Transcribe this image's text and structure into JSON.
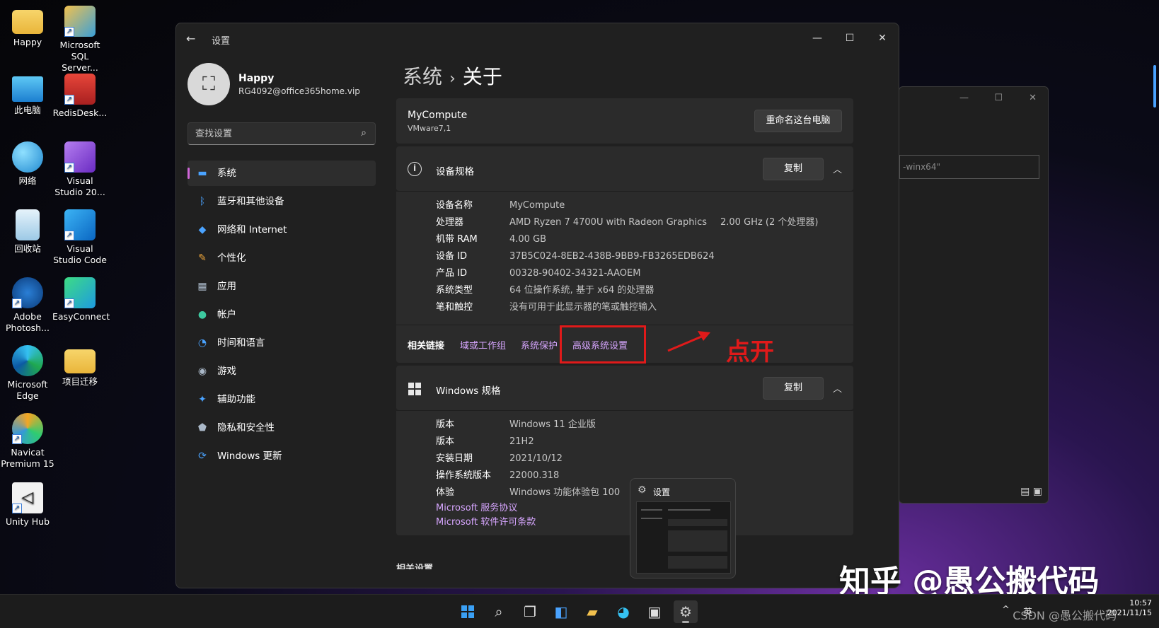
{
  "desktop": {
    "icons": [
      {
        "label": "Happy"
      },
      {
        "label": "Microsoft SQL Server..."
      },
      {
        "label": "此电脑"
      },
      {
        "label": "RedisDesk..."
      },
      {
        "label": "网络"
      },
      {
        "label": "Visual Studio 20..."
      },
      {
        "label": "回收站"
      },
      {
        "label": "Visual Studio Code"
      },
      {
        "label": "Adobe Photosh..."
      },
      {
        "label": "EasyConnect"
      },
      {
        "label": "Microsoft Edge"
      },
      {
        "label": "项目迁移"
      },
      {
        "label": "Navicat Premium 15"
      },
      {
        "label": "Unity Hub"
      }
    ]
  },
  "bg_window": {
    "input_value": "-winx64\""
  },
  "window": {
    "title": "设置",
    "back": "←",
    "minimize": "—",
    "maximize": "☐",
    "close": "✕"
  },
  "profile": {
    "name": "Happy",
    "email": "RG4092@office365home.vip"
  },
  "search": {
    "placeholder": "查找设置"
  },
  "nav": {
    "items": [
      {
        "label": "系统",
        "icon": "display-icon"
      },
      {
        "label": "蓝牙和其他设备",
        "icon": "bluetooth-icon"
      },
      {
        "label": "网络和 Internet",
        "icon": "wifi-icon"
      },
      {
        "label": "个性化",
        "icon": "brush-icon"
      },
      {
        "label": "应用",
        "icon": "apps-icon"
      },
      {
        "label": "帐户",
        "icon": "person-icon"
      },
      {
        "label": "时间和语言",
        "icon": "globe-clock-icon"
      },
      {
        "label": "游戏",
        "icon": "gamepad-icon"
      },
      {
        "label": "辅助功能",
        "icon": "accessibility-icon"
      },
      {
        "label": "隐私和安全性",
        "icon": "shield-icon"
      },
      {
        "label": "Windows 更新",
        "icon": "update-icon"
      }
    ]
  },
  "breadcrumb": {
    "parent": "系统",
    "separator": "›",
    "current": "关于"
  },
  "pc": {
    "name": "MyCompute",
    "model": "VMware7,1",
    "rename_label": "重命名这台电脑"
  },
  "device_specs": {
    "title": "设备规格",
    "copy_label": "复制",
    "rows": [
      {
        "label": "设备名称",
        "value": "MyCompute",
        "extra": ""
      },
      {
        "label": "处理器",
        "value": "AMD Ryzen 7 4700U with Radeon Graphics",
        "extra": "2.00 GHz  (2 个处理器)"
      },
      {
        "label": "机带 RAM",
        "value": "4.00 GB",
        "extra": ""
      },
      {
        "label": "设备 ID",
        "value": "37B5C024-8EB2-438B-9BB9-FB3265EDB624",
        "extra": ""
      },
      {
        "label": "产品 ID",
        "value": "00328-90402-34321-AAOEM",
        "extra": ""
      },
      {
        "label": "系统类型",
        "value": "64 位操作系统, 基于 x64 的处理器",
        "extra": ""
      },
      {
        "label": "笔和触控",
        "value": "没有可用于此显示器的笔或触控输入",
        "extra": ""
      }
    ]
  },
  "related_links": {
    "title": "相关链接",
    "links": [
      "域或工作组",
      "系统保护",
      "高级系统设置"
    ]
  },
  "annotation": {
    "text": "点开",
    "color": "#e01a1a"
  },
  "windows_specs": {
    "title": "Windows 规格",
    "copy_label": "复制",
    "rows": [
      {
        "label": "版本",
        "value": "Windows 11 企业版"
      },
      {
        "label": "版本",
        "value": "21H2"
      },
      {
        "label": "安装日期",
        "value": "2021/10/12"
      },
      {
        "label": "操作系统版本",
        "value": "22000.318"
      },
      {
        "label": "体验",
        "value": "Windows 功能体验包 100"
      }
    ],
    "links": [
      "Microsoft 服务协议",
      "Microsoft 软件许可条款"
    ]
  },
  "related_settings_title": "相关设置",
  "preview": {
    "title": "设置"
  },
  "watermark": "知乎 @愚公搬代码",
  "taskbar": {
    "tray_chevron": "^",
    "ime": "英",
    "csdn": "CSDN @愚公搬代码",
    "time": "10:57",
    "date": "2021/11/15"
  },
  "colors": {
    "accent": "#d066d8",
    "link": "#d7a6ff",
    "highlight": "#e01a1a"
  }
}
